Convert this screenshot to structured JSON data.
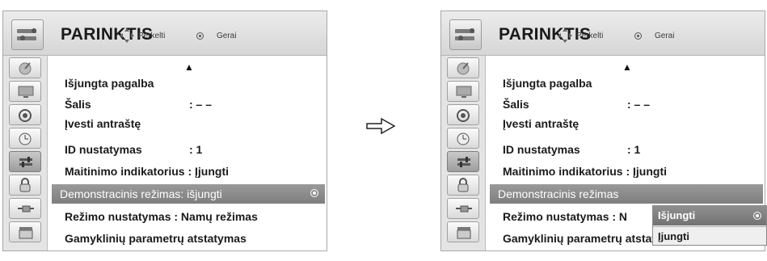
{
  "menu": {
    "title": "PARINKTIS",
    "hint_move": "Perkelti",
    "hint_ok": "Gerai",
    "scroll_up": "▲",
    "items": [
      {
        "label": "Išjungta pagalba",
        "value": ""
      },
      {
        "label": "Šalis",
        "value": ": – –"
      },
      {
        "label": "Įvesti antraštę",
        "value": ""
      },
      {
        "label": "ID nustatymas",
        "value": ": 1"
      },
      {
        "label": "Maitinimo indikatorius : Įjungti",
        "value": ""
      },
      {
        "label": "Demonstracinis režimas: išjungti",
        "value": ""
      },
      {
        "label": "Režimo nustatymas  : Namų režimas",
        "value": ""
      },
      {
        "label": "Gamyklinių parametrų atstatymas",
        "value": ""
      }
    ],
    "right_items": [
      {
        "label": "Išjungta pagalba",
        "value": ""
      },
      {
        "label": "Šalis",
        "value": ": – –"
      },
      {
        "label": "Įvesti antraštę",
        "value": ""
      },
      {
        "label": "ID nustatymas",
        "value": ": 1"
      },
      {
        "label": "Maitinimo indikatorius : Įjungti",
        "value": ""
      },
      {
        "label": "Demonstracinis režimas",
        "value": ""
      },
      {
        "label": "Režimo nustatymas  : N",
        "value": ""
      },
      {
        "label": "Gamyklinių parametrų atstatymas",
        "value": ""
      }
    ]
  },
  "sidebar_icons": [
    "satellite-icon",
    "monitor-icon",
    "speaker-icon",
    "clock-icon",
    "options-icon",
    "lock-icon",
    "input-plug-icon",
    "clapper-icon"
  ],
  "dropdown": {
    "options": [
      "Išjungti",
      "Įjungti"
    ],
    "selected": "Išjungti"
  },
  "transition_arrow": "⇨"
}
